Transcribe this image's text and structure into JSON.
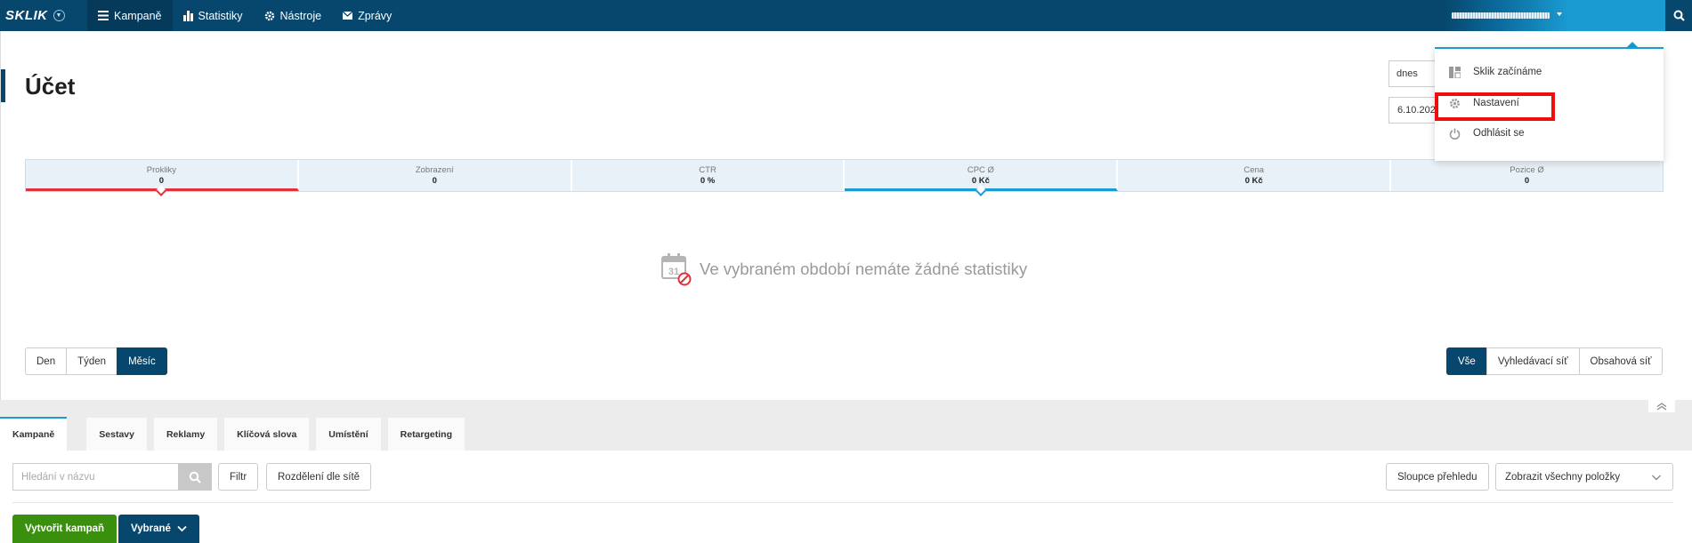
{
  "topbar": {
    "logo": "SKLIK",
    "nav": [
      {
        "label": "Kampaně",
        "icon": "menu-icon",
        "active": true
      },
      {
        "label": "Statistiky",
        "icon": "bar-chart-icon",
        "active": false
      },
      {
        "label": "Nástroje",
        "icon": "gear-icon",
        "active": false
      },
      {
        "label": "Zprávy",
        "icon": "envelope-icon",
        "active": false
      }
    ]
  },
  "account": {
    "title": "Účet",
    "period_select": "dnes",
    "date_input": "6.10.2023",
    "metrics": [
      {
        "label": "Prokliky",
        "value": "0"
      },
      {
        "label": "Zobrazení",
        "value": "0"
      },
      {
        "label": "CTR",
        "value": "0 %"
      },
      {
        "label": "CPC Ø",
        "value": "0 Kč"
      },
      {
        "label": "Cena",
        "value": "0 Kč"
      },
      {
        "label": "Pozice Ø",
        "value": "0"
      }
    ],
    "empty_message": "Ve vybraném období nemáte žádné statistiky",
    "calendar_day": "31",
    "granularity": [
      "Den",
      "Týden",
      "Měsíc"
    ],
    "network": [
      "Vše",
      "Vyhledávací síť",
      "Obsahová síť"
    ]
  },
  "tabs": [
    "Kampaně",
    "Sestavy",
    "Reklamy",
    "Klíčová slova",
    "Umístění",
    "Retargeting"
  ],
  "toolbar": {
    "search_placeholder": "Hledání v názvu",
    "filter": "Filtr",
    "split": "Rozdělení dle sítě",
    "columns": "Sloupce přehledu",
    "show_select": "Zobrazit všechny položky",
    "create": "Vytvořit kampaň",
    "selected": "Vybrané"
  },
  "user_menu": {
    "items": [
      {
        "label": "Sklik začínáme",
        "icon": "dashboard-icon"
      },
      {
        "label": "Nastavení",
        "icon": "gear-icon"
      },
      {
        "label": "Odhlásit se",
        "icon": "power-icon"
      }
    ]
  },
  "colors": {
    "brand": "#07476e",
    "accent": "#1a9bd1",
    "green": "#3a8f0f",
    "highlight": "#ee0e0e"
  }
}
